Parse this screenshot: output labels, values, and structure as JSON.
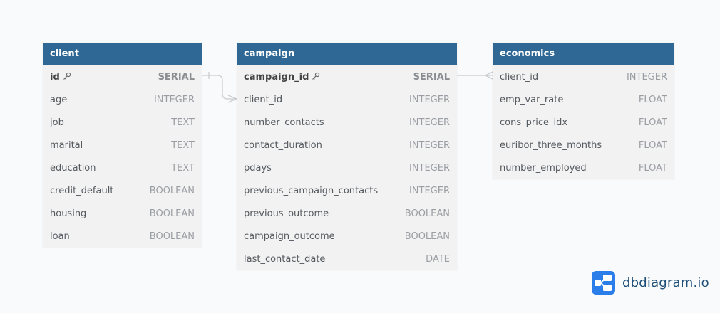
{
  "tables": {
    "client": {
      "title": "client",
      "columns": [
        {
          "name": "id",
          "type": "SERIAL",
          "pk": true
        },
        {
          "name": "age",
          "type": "INTEGER"
        },
        {
          "name": "job",
          "type": "TEXT"
        },
        {
          "name": "marital",
          "type": "TEXT"
        },
        {
          "name": "education",
          "type": "TEXT"
        },
        {
          "name": "credit_default",
          "type": "BOOLEAN"
        },
        {
          "name": "housing",
          "type": "BOOLEAN"
        },
        {
          "name": "loan",
          "type": "BOOLEAN"
        }
      ]
    },
    "campaign": {
      "title": "campaign",
      "columns": [
        {
          "name": "campaign_id",
          "type": "SERIAL",
          "pk": true
        },
        {
          "name": "client_id",
          "type": "INTEGER"
        },
        {
          "name": "number_contacts",
          "type": "INTEGER"
        },
        {
          "name": "contact_duration",
          "type": "INTEGER"
        },
        {
          "name": "pdays",
          "type": "INTEGER"
        },
        {
          "name": "previous_campaign_contacts",
          "type": "INTEGER"
        },
        {
          "name": "previous_outcome",
          "type": "BOOLEAN"
        },
        {
          "name": "campaign_outcome",
          "type": "BOOLEAN"
        },
        {
          "name": "last_contact_date",
          "type": "DATE"
        }
      ]
    },
    "economics": {
      "title": "economics",
      "columns": [
        {
          "name": "client_id",
          "type": "INTEGER"
        },
        {
          "name": "emp_var_rate",
          "type": "FLOAT"
        },
        {
          "name": "cons_price_idx",
          "type": "FLOAT"
        },
        {
          "name": "euribor_three_months",
          "type": "FLOAT"
        },
        {
          "name": "number_employed",
          "type": "FLOAT"
        }
      ]
    }
  },
  "brand": {
    "text": "dbdiagram.io",
    "icon": "dbdiagram-logo-icon",
    "color": "#2b7de9"
  },
  "colors": {
    "header": "#2f6894",
    "connector": "#c8ccd0"
  }
}
